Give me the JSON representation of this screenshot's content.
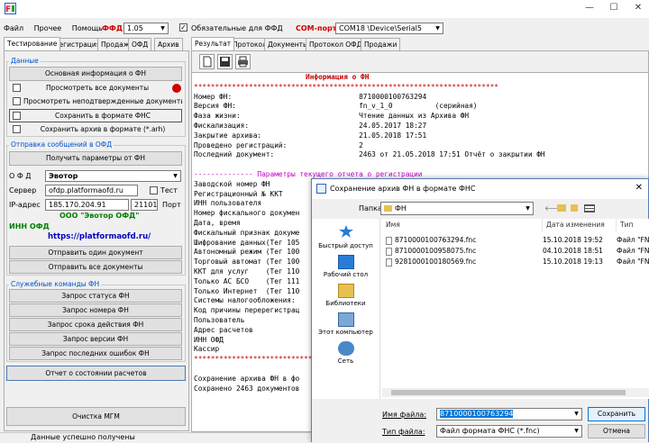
{
  "app": {
    "icon_name": "app-logo-icon",
    "window_controls": [
      "—",
      "☐",
      "✕"
    ]
  },
  "menu": {
    "items": [
      "Файл",
      "Прочее",
      "Помощь"
    ],
    "ffd_label": "ФФД",
    "ffd_value": "1.05",
    "mandatory_label": "Обязательные для ФФД",
    "mandatory_checked": true,
    "com_label": "COM-порт",
    "com_value": "COM18 \\Device\\Serial5"
  },
  "left_tabs": [
    "Тестирование",
    "Регистрация",
    "Продажи",
    "ОФД",
    "Архив"
  ],
  "data_group": {
    "label": "Данные",
    "btn_info": "Основная информация о ФН",
    "btn_view_all": "Просмотреть все документы",
    "btn_view_unconfirmed": "Просмотреть неподтвержденные документы",
    "btn_save_fns": "Сохранить в формате ФНС",
    "btn_save_arh": "Сохранить архив в формате (*.arh)"
  },
  "ofd_group": {
    "label": "Отправка сообщений в ОФД",
    "btn_params": "Получить параметры от ФН",
    "ofd_label": "О Ф Д",
    "ofd_value": "Эвотор",
    "server_label": "Сервер",
    "server_value": "ofdp.platformaofd.ru",
    "test_label": "Тест",
    "ip_label": "IP-адрес",
    "ip_value": "185.170.204.91",
    "port_value": "21101",
    "port_label": "Порт",
    "company": "ООО \"Эвотор ОФД\"",
    "inn": "ИНН ОФД",
    "url": "https://platformaofd.ru/",
    "btn_send_one": "Отправить один документ",
    "btn_send_all": "Отправить все документы"
  },
  "service_group": {
    "label": "Служебные команды ФН",
    "buttons": [
      "Запрос статуса ФН",
      "Запрос номера ФН",
      "Запрос срока действия ФН",
      "Запрос версии ФН",
      "Запрос последних ошибок ФН"
    ]
  },
  "btn_report": "Отчет о состоянии расчетов",
  "btn_clear": "Очистка МГМ",
  "status_text": "Данные успешно получены",
  "right_tabs": [
    "Результат",
    "Протокол",
    "Документы",
    "Протокол ОФД",
    "Продажи"
  ],
  "log": {
    "title": "Информация о ФН",
    "stars": "************************************************************************",
    "lines": [
      "Номер ФН:                              8710000100763294",
      "Версия ФН:                             fn_v_1_0          (серийная)",
      "Фаза жизни:                            Чтение данных из Архива ФН",
      "Фискализация:                          24.05.2017 18:27",
      "Закрытие архива:                       21.05.2018 17:51",
      "Проведено регистраций:                 2",
      "Последний документ:                    2463 от 21.05.2018 17:51 Отчёт о закрытии ФН"
    ],
    "params_header": "-------------- Параметры текущего отчета о регистрации",
    "params": [
      "Заводской номер ФН",
      "Регистрационный № ККТ",
      "ИНН пользователя",
      "Номер фискального докумен",
      "Дата, время",
      "Фискальный признак докуме",
      "Шифрование данных(Тег 105",
      "Автономный режим (Тег 100",
      "Торговый автомат (Тег 100",
      "ККТ для услуг    (Тег 110",
      "Только АС БСО    (Тег 111",
      "Только Интернет  (Тег 110",
      "Системы налогообложения:",
      "Код причины перерегистрац",
      "Пользователь",
      "Адрес расчетов",
      "ИНН ОФД",
      "Кассир"
    ],
    "stars2": "************************************************************************",
    "footer": [
      "Сохранение архива ФН в фо",
      "Сохранено 2463 документов"
    ]
  },
  "dialog": {
    "title": "Сохранение архив ФН в формате ФНС",
    "close": "✕",
    "folder_label": "Папка:",
    "folder_value": "ФН",
    "places": [
      "Быстрый доступ",
      "Рабочий стол",
      "Библиотеки",
      "Этот компьютер",
      "Сеть"
    ],
    "columns": [
      "Имя",
      "Дата изменения",
      "Тип"
    ],
    "files": [
      {
        "name": "8710000100763294.fnc",
        "date": "15.10.2018 19:52",
        "type": "Файл \"FN"
      },
      {
        "name": "8710000100958075.fnc",
        "date": "04.10.2018 18:51",
        "type": "Файл \"FN"
      },
      {
        "name": "9281000100180569.fnc",
        "date": "15.10.2018 19:13",
        "type": "Файл \"FN"
      }
    ],
    "filename_label": "Имя файла:",
    "filename_value": "8710000100763294",
    "filetype_label": "Тип файла:",
    "filetype_value": "Файл формата ФНС (*.fnc)",
    "btn_save": "Сохранить",
    "btn_cancel": "Отмена"
  },
  "colors": {
    "accent_red": "#d00000",
    "link_blue": "#0000c0",
    "green": "#008000",
    "group_blue": "#0050c8"
  }
}
